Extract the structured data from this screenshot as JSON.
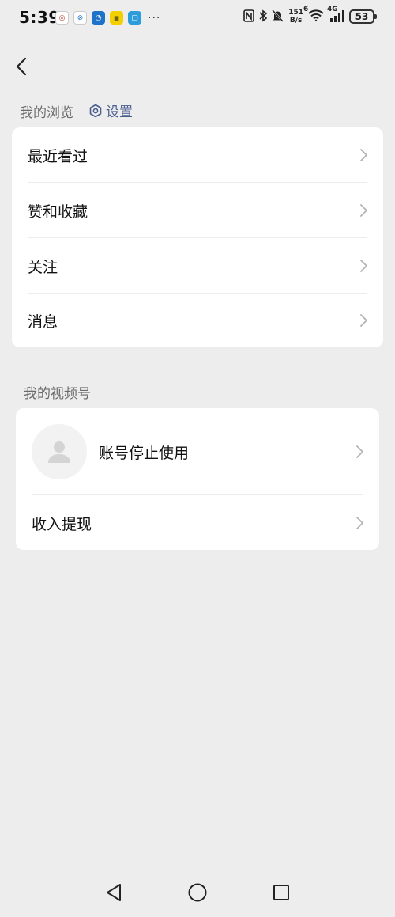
{
  "status_bar": {
    "time": "5:39",
    "more": "···",
    "net_speed_value": "151",
    "net_speed_unit": "B/s",
    "wifi_label": "6",
    "cell_label": "4G",
    "battery": "53"
  },
  "header": {
    "back_icon": "chevron-left-icon"
  },
  "browse_section": {
    "title": "我的浏览",
    "settings_label": "设置",
    "items": [
      {
        "label": "最近看过"
      },
      {
        "label": "赞和收藏"
      },
      {
        "label": "关注"
      },
      {
        "label": "消息"
      }
    ]
  },
  "channels_section": {
    "title": "我的视频号",
    "account_label": "账号停止使用",
    "income_label": "收入提现"
  },
  "colors": {
    "background": "#ededed",
    "card": "#ffffff",
    "link": "#4a5d8f",
    "chevron": "#b3b3b3"
  }
}
